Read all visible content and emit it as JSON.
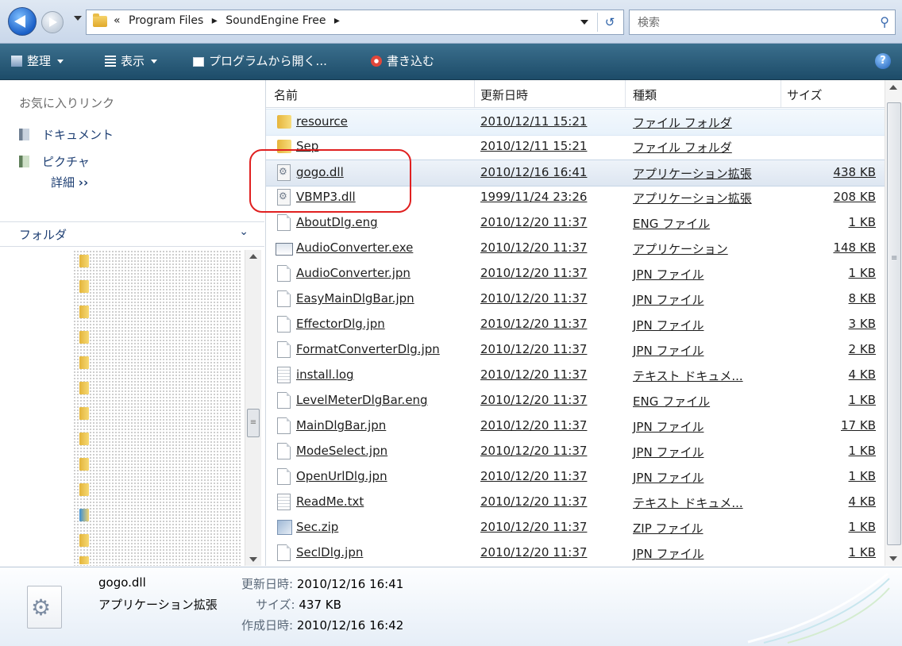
{
  "address": {
    "breadcrumbs": [
      "«",
      "Program Files",
      "▸",
      "SoundEngine Free",
      "▸"
    ],
    "search_placeholder": "検索"
  },
  "toolbar": {
    "organize": "整理",
    "views": "表示",
    "open_with": "プログラムから開く...",
    "burn": "書き込む",
    "help": "?"
  },
  "sidebar": {
    "favorites_heading": "お気に入りリンク",
    "favorites": [
      "ドキュメント",
      "ピクチャ"
    ],
    "more": "詳細",
    "more_arrow": "››",
    "folders_label": "フォルダ"
  },
  "columns": [
    "名前",
    "更新日時",
    "種類",
    "サイズ"
  ],
  "files": [
    {
      "name": "resource",
      "date": "2010/12/11 15:21",
      "type": "ファイル フォルダ",
      "size": "",
      "icon": "folder-icon"
    },
    {
      "name": "Sep",
      "date": "2010/12/11 15:21",
      "type": "ファイル フォルダ",
      "size": "",
      "icon": "folder-icon"
    },
    {
      "name": "gogo.dll",
      "date": "2010/12/16 16:41",
      "type": "アプリケーション拡張",
      "size": "438 KB",
      "icon": "dll-icon"
    },
    {
      "name": "VBMP3.dll",
      "date": "1999/11/24 23:26",
      "type": "アプリケーション拡張",
      "size": "208 KB",
      "icon": "dll-icon"
    },
    {
      "name": "AboutDlg.eng",
      "date": "2010/12/20 11:37",
      "type": "ENG ファイル",
      "size": "1 KB",
      "icon": "document-icon"
    },
    {
      "name": "AudioConverter.exe",
      "date": "2010/12/20 11:37",
      "type": "アプリケーション",
      "size": "148 KB",
      "icon": "exe-icon"
    },
    {
      "name": "AudioConverter.jpn",
      "date": "2010/12/20 11:37",
      "type": "JPN ファイル",
      "size": "1 KB",
      "icon": "document-icon"
    },
    {
      "name": "EasyMainDlgBar.jpn",
      "date": "2010/12/20 11:37",
      "type": "JPN ファイル",
      "size": "8 KB",
      "icon": "document-icon"
    },
    {
      "name": "EffectorDlg.jpn",
      "date": "2010/12/20 11:37",
      "type": "JPN ファイル",
      "size": "3 KB",
      "icon": "document-icon"
    },
    {
      "name": "FormatConverterDlg.jpn",
      "date": "2010/12/20 11:37",
      "type": "JPN ファイル",
      "size": "2 KB",
      "icon": "document-icon"
    },
    {
      "name": "install.log",
      "date": "2010/12/20 11:37",
      "type": "テキスト ドキュメ...",
      "size": "4 KB",
      "icon": "text-file-icon"
    },
    {
      "name": "LevelMeterDlgBar.eng",
      "date": "2010/12/20 11:37",
      "type": "ENG ファイル",
      "size": "1 KB",
      "icon": "document-icon"
    },
    {
      "name": "MainDlgBar.jpn",
      "date": "2010/12/20 11:37",
      "type": "JPN ファイル",
      "size": "17 KB",
      "icon": "document-icon"
    },
    {
      "name": "ModeSelect.jpn",
      "date": "2010/12/20 11:37",
      "type": "JPN ファイル",
      "size": "1 KB",
      "icon": "document-icon"
    },
    {
      "name": "OpenUrlDlg.jpn",
      "date": "2010/12/20 11:37",
      "type": "JPN ファイル",
      "size": "1 KB",
      "icon": "document-icon"
    },
    {
      "name": "ReadMe.txt",
      "date": "2010/12/20 11:37",
      "type": "テキスト ドキュメ...",
      "size": "4 KB",
      "icon": "text-file-icon"
    },
    {
      "name": "Sec.zip",
      "date": "2010/12/20 11:37",
      "type": "ZIP ファイル",
      "size": "1 KB",
      "icon": "zip-icon"
    },
    {
      "name": "SeclDlg.jpn",
      "date": "2010/12/20 11:37",
      "type": "JPN ファイル",
      "size": "1 KB",
      "icon": "document-icon"
    }
  ],
  "details": {
    "file_name": "gogo.dll",
    "file_type": "アプリケーション拡張",
    "modified_label": "更新日時:",
    "modified_value": "2010/12/16 16:41",
    "size_label": "サイズ:",
    "size_value": "437 KB",
    "created_label": "作成日時:",
    "created_value": "2010/12/16 16:42"
  },
  "colors": {
    "toolbar": "#1d4c69",
    "link": "#1e3f73",
    "annotation": "#e02020"
  }
}
